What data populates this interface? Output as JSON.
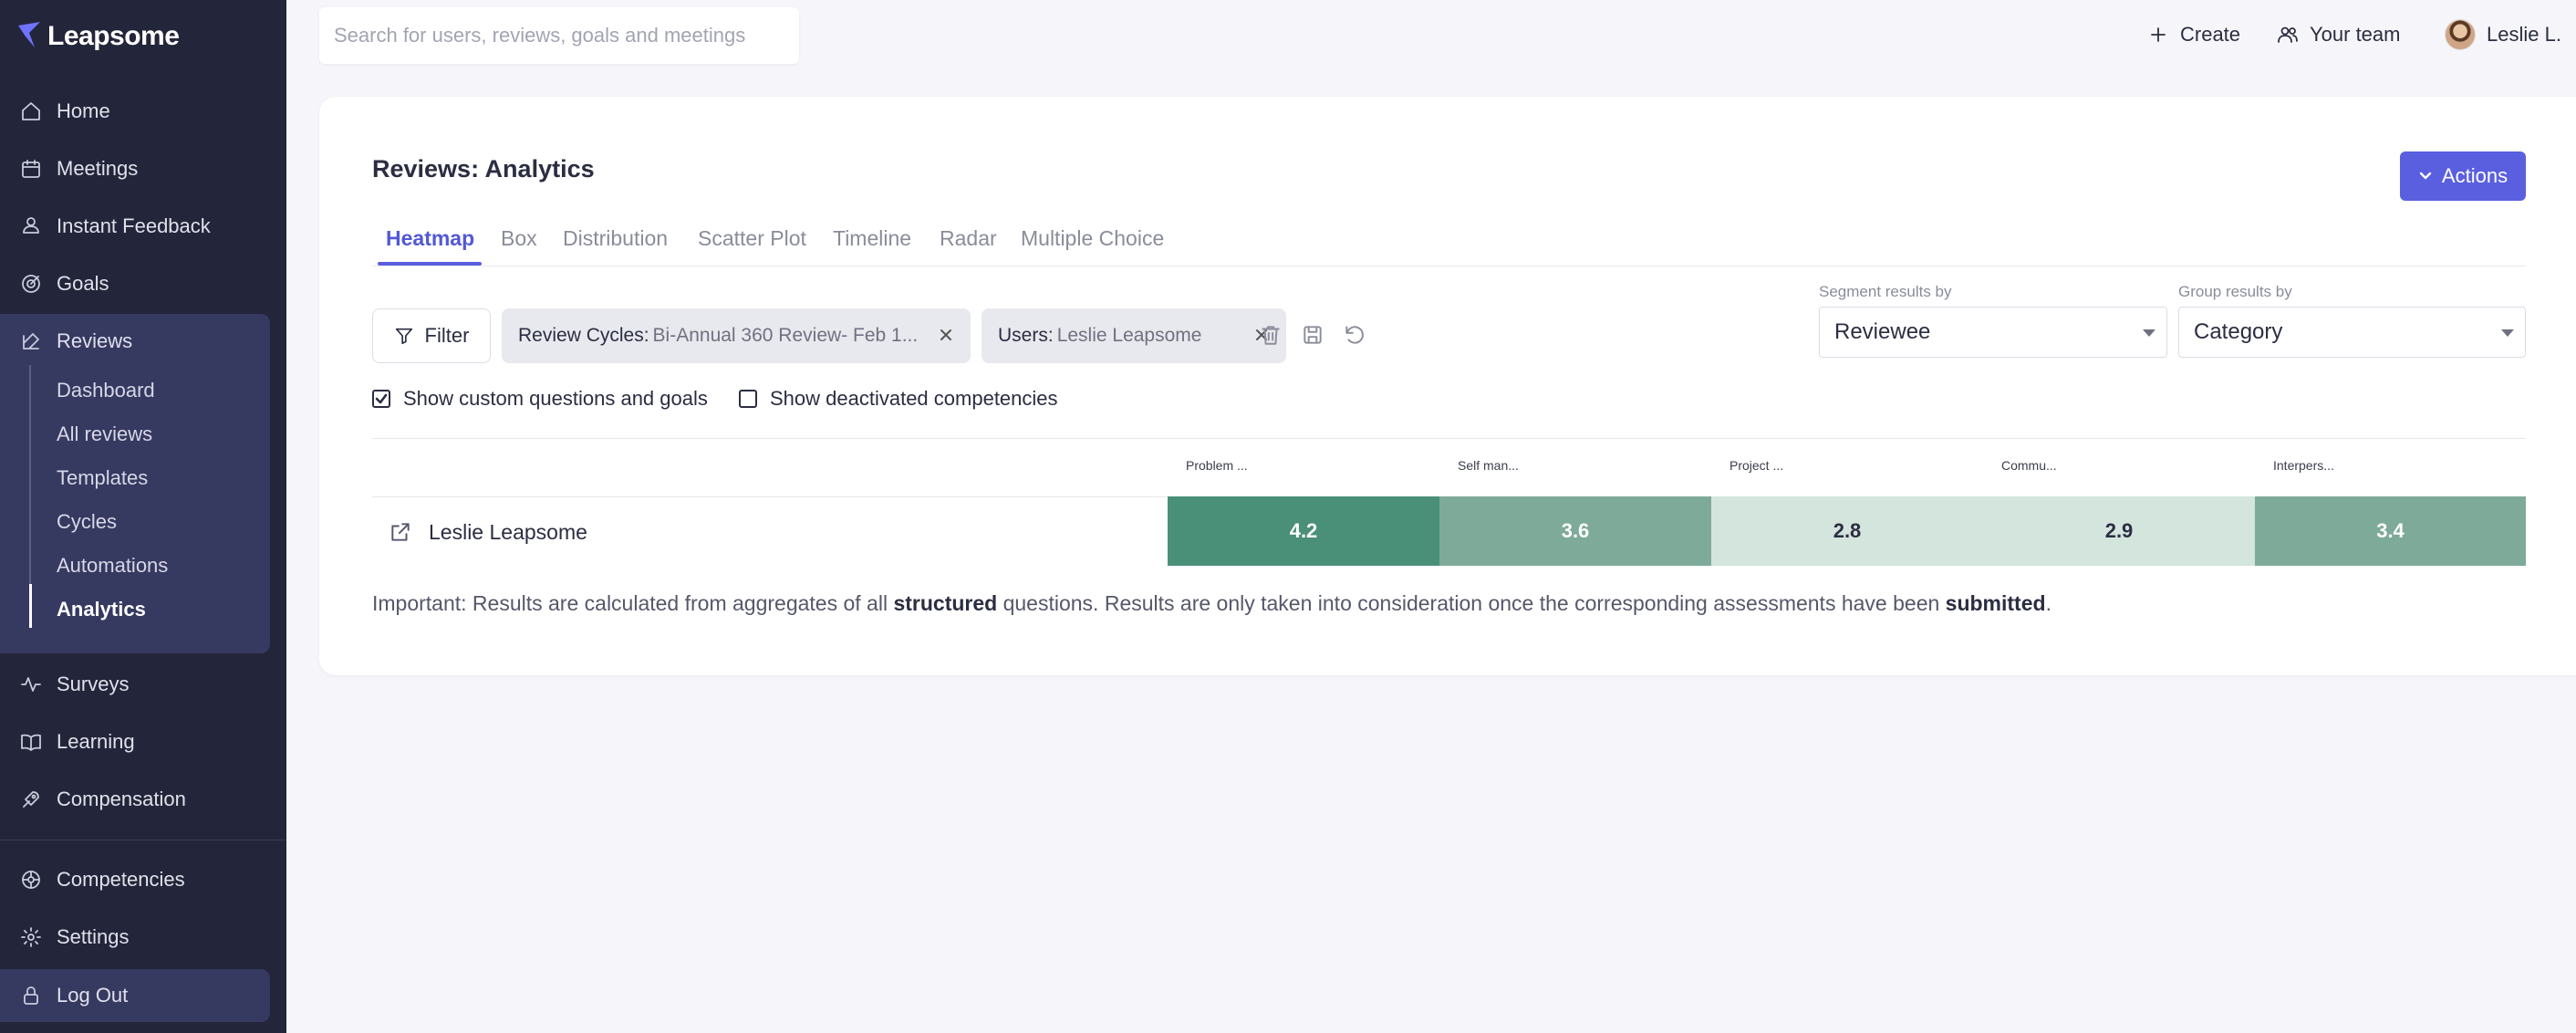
{
  "app": {
    "brand": "Leapsome"
  },
  "sidebar": {
    "items": [
      {
        "label": "Home",
        "icon": "home-icon"
      },
      {
        "label": "Meetings",
        "icon": "meetings-icon"
      },
      {
        "label": "Instant Feedback",
        "icon": "feedback-icon"
      },
      {
        "label": "Goals",
        "icon": "goals-icon"
      },
      {
        "label": "Reviews",
        "icon": "reviews-icon"
      },
      {
        "label": "Surveys",
        "icon": "surveys-icon"
      },
      {
        "label": "Learning",
        "icon": "learning-icon"
      },
      {
        "label": "Compensation",
        "icon": "compensation-icon"
      },
      {
        "label": "Competencies",
        "icon": "competencies-icon"
      },
      {
        "label": "Settings",
        "icon": "settings-icon"
      },
      {
        "label": "Log Out",
        "icon": "lock-icon"
      }
    ],
    "reviews_sub": [
      "Dashboard",
      "All reviews",
      "Templates",
      "Cycles",
      "Automations",
      "Analytics"
    ],
    "active_sub": "Analytics"
  },
  "header": {
    "search_placeholder": "Search for users, reviews, goals and meetings",
    "create_label": "Create",
    "team_label": "Your team",
    "user_label": "Leslie L."
  },
  "page": {
    "title": "Reviews: Analytics",
    "actions_label": "Actions",
    "tabs": [
      "Heatmap",
      "Box",
      "Distribution",
      "Scatter Plot",
      "Timeline",
      "Radar",
      "Multiple Choice"
    ],
    "active_tab": "Heatmap"
  },
  "filters": {
    "filter_label": "Filter",
    "chips": [
      {
        "key": "Review Cycles:",
        "value": "Bi-Annual 360 Review- Feb 1..."
      },
      {
        "key": "Users:",
        "value": "Leslie Leapsome"
      }
    ],
    "segment_label": "Segment results by",
    "segment_value": "Reviewee",
    "group_label": "Group results by",
    "group_value": "Category",
    "show_custom_label": "Show custom questions and goals",
    "show_custom_checked": true,
    "show_deactivated_label": "Show deactivated competencies",
    "show_deactivated_checked": false
  },
  "chart_data": {
    "type": "heatmap",
    "columns": [
      "Problem ...",
      "Self man...",
      "Project ...",
      "Commu...",
      "Interpers..."
    ],
    "rows": [
      {
        "name": "Leslie Leapsome",
        "values": [
          4.2,
          3.6,
          2.8,
          2.9,
          3.4
        ]
      }
    ],
    "colors": {
      "high": "#4a9079",
      "mid": "#7eaa9a",
      "low": "#d3e5dd"
    }
  },
  "note": {
    "prefix": "Important: Results are calculated from aggregates of all ",
    "bold1": "structured",
    "middle": " questions. Results are only taken into consideration once the corresponding assessments have been ",
    "bold2": "submitted",
    "suffix": "."
  },
  "colors": {
    "sidebar_bg": "#23253a",
    "accent": "#5a5fe0"
  }
}
